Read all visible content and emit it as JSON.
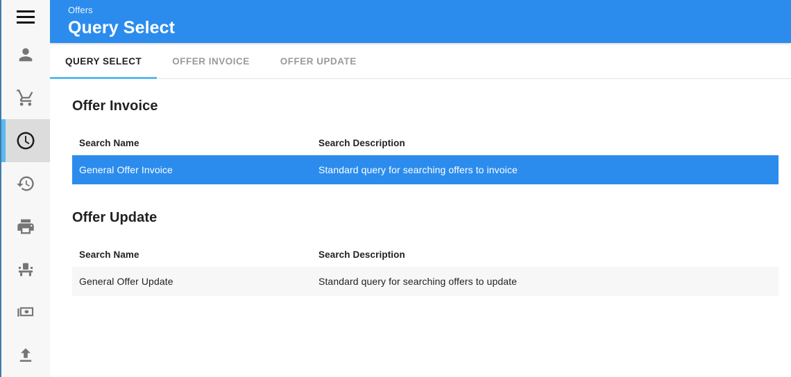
{
  "sidebar": {
    "menu_button": {
      "icon": "hamburger-menu-icon",
      "label": "Menu"
    },
    "items": [
      {
        "icon": "person-icon",
        "name": "person",
        "active": false
      },
      {
        "icon": "shopping-cart-icon",
        "name": "shopping-cart",
        "active": false
      },
      {
        "icon": "clock-icon",
        "name": "clock",
        "active": true
      },
      {
        "icon": "history-icon",
        "name": "history",
        "active": false
      },
      {
        "icon": "printer-icon",
        "name": "printer",
        "active": false
      },
      {
        "icon": "scale-icon",
        "name": "scale",
        "active": false
      },
      {
        "icon": "cash-icon",
        "name": "cash",
        "active": false
      },
      {
        "icon": "upload-icon",
        "name": "upload",
        "active": false
      }
    ]
  },
  "header": {
    "subtitle": "Offers",
    "title": "Query Select",
    "background_color": "#2b8cee"
  },
  "tabs": [
    {
      "label": "QUERY SELECT",
      "active": true
    },
    {
      "label": "OFFER INVOICE",
      "active": false
    },
    {
      "label": "OFFER UPDATE",
      "active": false
    }
  ],
  "tab_indicator_color": "#5bb9f0",
  "sections": [
    {
      "title": "Offer Invoice",
      "columns": [
        "Search Name",
        "Search Description"
      ],
      "rows": [
        {
          "search_name": "General Offer Invoice",
          "search_description": "Standard query for searching offers to invoice",
          "selected": true
        }
      ]
    },
    {
      "title": "Offer Update",
      "columns": [
        "Search Name",
        "Search Description"
      ],
      "rows": [
        {
          "search_name": "General Offer Update",
          "search_description": "Standard query for searching offers to update",
          "selected": false
        }
      ]
    }
  ],
  "colors": {
    "accent": "#2b8cee",
    "accent_light": "#5bb9f0",
    "selected_row": "#2b8cee",
    "plain_row": "#f7f7f7",
    "sidebar_bg": "#f7f7f7",
    "sidebar_active_bg": "#dcdcdc",
    "sidebar_edge": "#3d7ca8"
  }
}
